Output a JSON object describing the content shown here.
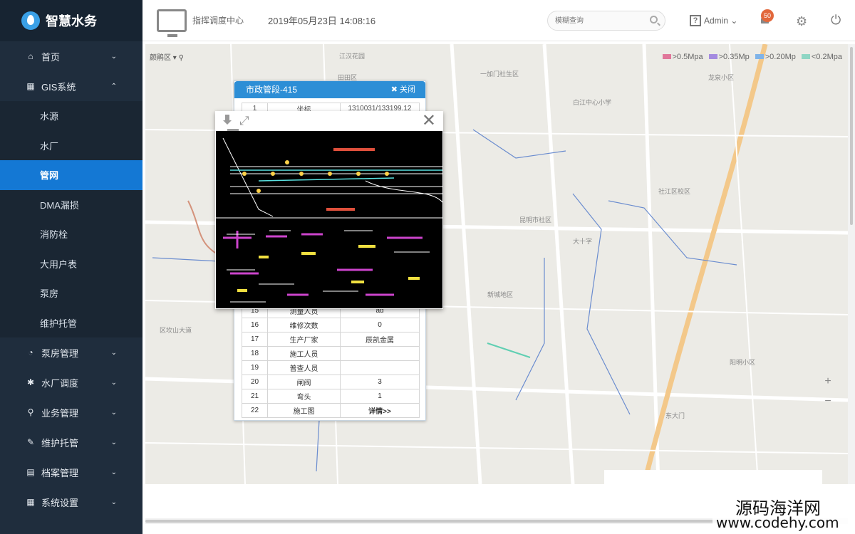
{
  "brand": {
    "title": "智慧水务"
  },
  "sidebar": {
    "items": [
      {
        "label": "首页",
        "icon": "home-icon",
        "glyph": "⌂",
        "chevron": "⌄"
      },
      {
        "label": "GIS系统",
        "icon": "grid-icon",
        "glyph": "▦",
        "chevron": "⌃"
      }
    ],
    "subitems": [
      {
        "label": "水源",
        "active": false
      },
      {
        "label": "水厂",
        "active": false
      },
      {
        "label": "管网",
        "active": true
      },
      {
        "label": "DMA漏损",
        "active": false
      },
      {
        "label": "消防栓",
        "active": false
      },
      {
        "label": "大用户表",
        "active": false
      },
      {
        "label": "泵房",
        "active": false
      },
      {
        "label": "维护托管",
        "active": false
      }
    ],
    "bottom_items": [
      {
        "label": "泵房管理",
        "icon": "pie-icon",
        "glyph": "◔"
      },
      {
        "label": "水厂调度",
        "icon": "gear-icon",
        "glyph": "✱"
      },
      {
        "label": "业务管理",
        "icon": "sitemap-icon",
        "glyph": "⚲"
      },
      {
        "label": "维护托管",
        "icon": "edit-icon",
        "glyph": "✎"
      },
      {
        "label": "档案管理",
        "icon": "archive-icon",
        "glyph": "▤"
      },
      {
        "label": "系统设置",
        "icon": "calendar-icon",
        "glyph": "▦"
      }
    ]
  },
  "header": {
    "center_name": "指挥调度中心",
    "datetime": "2019年05月23日 14:08:16",
    "search_placeholder": "模糊查询",
    "admin_label": "Admin ⌄",
    "notification_count": "50"
  },
  "map": {
    "toolbar_label": "颜鹃区 ▾  ⚲",
    "legend": [
      {
        "label": ">0.5Mpa",
        "color": "#e0779a"
      },
      {
        "label": ">0.35Mp",
        "color": "#a48be0"
      },
      {
        "label": ">0.20Mp",
        "color": "#7fb3e8"
      },
      {
        "label": "<0.2Mpa",
        "color": "#8fd6c4"
      }
    ],
    "labels": [
      "江汉花园",
      "一加门社生区",
      "白江中心小学",
      "田田区",
      "社江区校区",
      "昆明市社区",
      "大十字",
      "龙泉小区",
      "新城地区",
      "阳明小区",
      "区坎山大道",
      "东大门"
    ]
  },
  "info_popup": {
    "title": "市政管段-415",
    "close_label": "✖ 关闭",
    "first_row": {
      "num": "1",
      "name": "坐标",
      "value": "1310031/133199.12"
    },
    "rows": [
      {
        "num": "15",
        "name": "测量人员",
        "value": "ad"
      },
      {
        "num": "16",
        "name": "维修次数",
        "value": "0"
      },
      {
        "num": "17",
        "name": "生产厂家",
        "value": "辰凯金属"
      },
      {
        "num": "18",
        "name": "施工人员",
        "value": ""
      },
      {
        "num": "19",
        "name": "普查人员",
        "value": ""
      },
      {
        "num": "20",
        "name": "闸阀",
        "value": "3"
      },
      {
        "num": "21",
        "name": "弯头",
        "value": "1"
      },
      {
        "num": "22",
        "name": "施工图",
        "value": "详情>>"
      }
    ]
  },
  "viewer": {
    "close_glyph": "✕",
    "fullscreen_glyph": "⤢"
  },
  "watermark": {
    "line1": "源码海洋网",
    "line2": "www.codehy.com"
  }
}
